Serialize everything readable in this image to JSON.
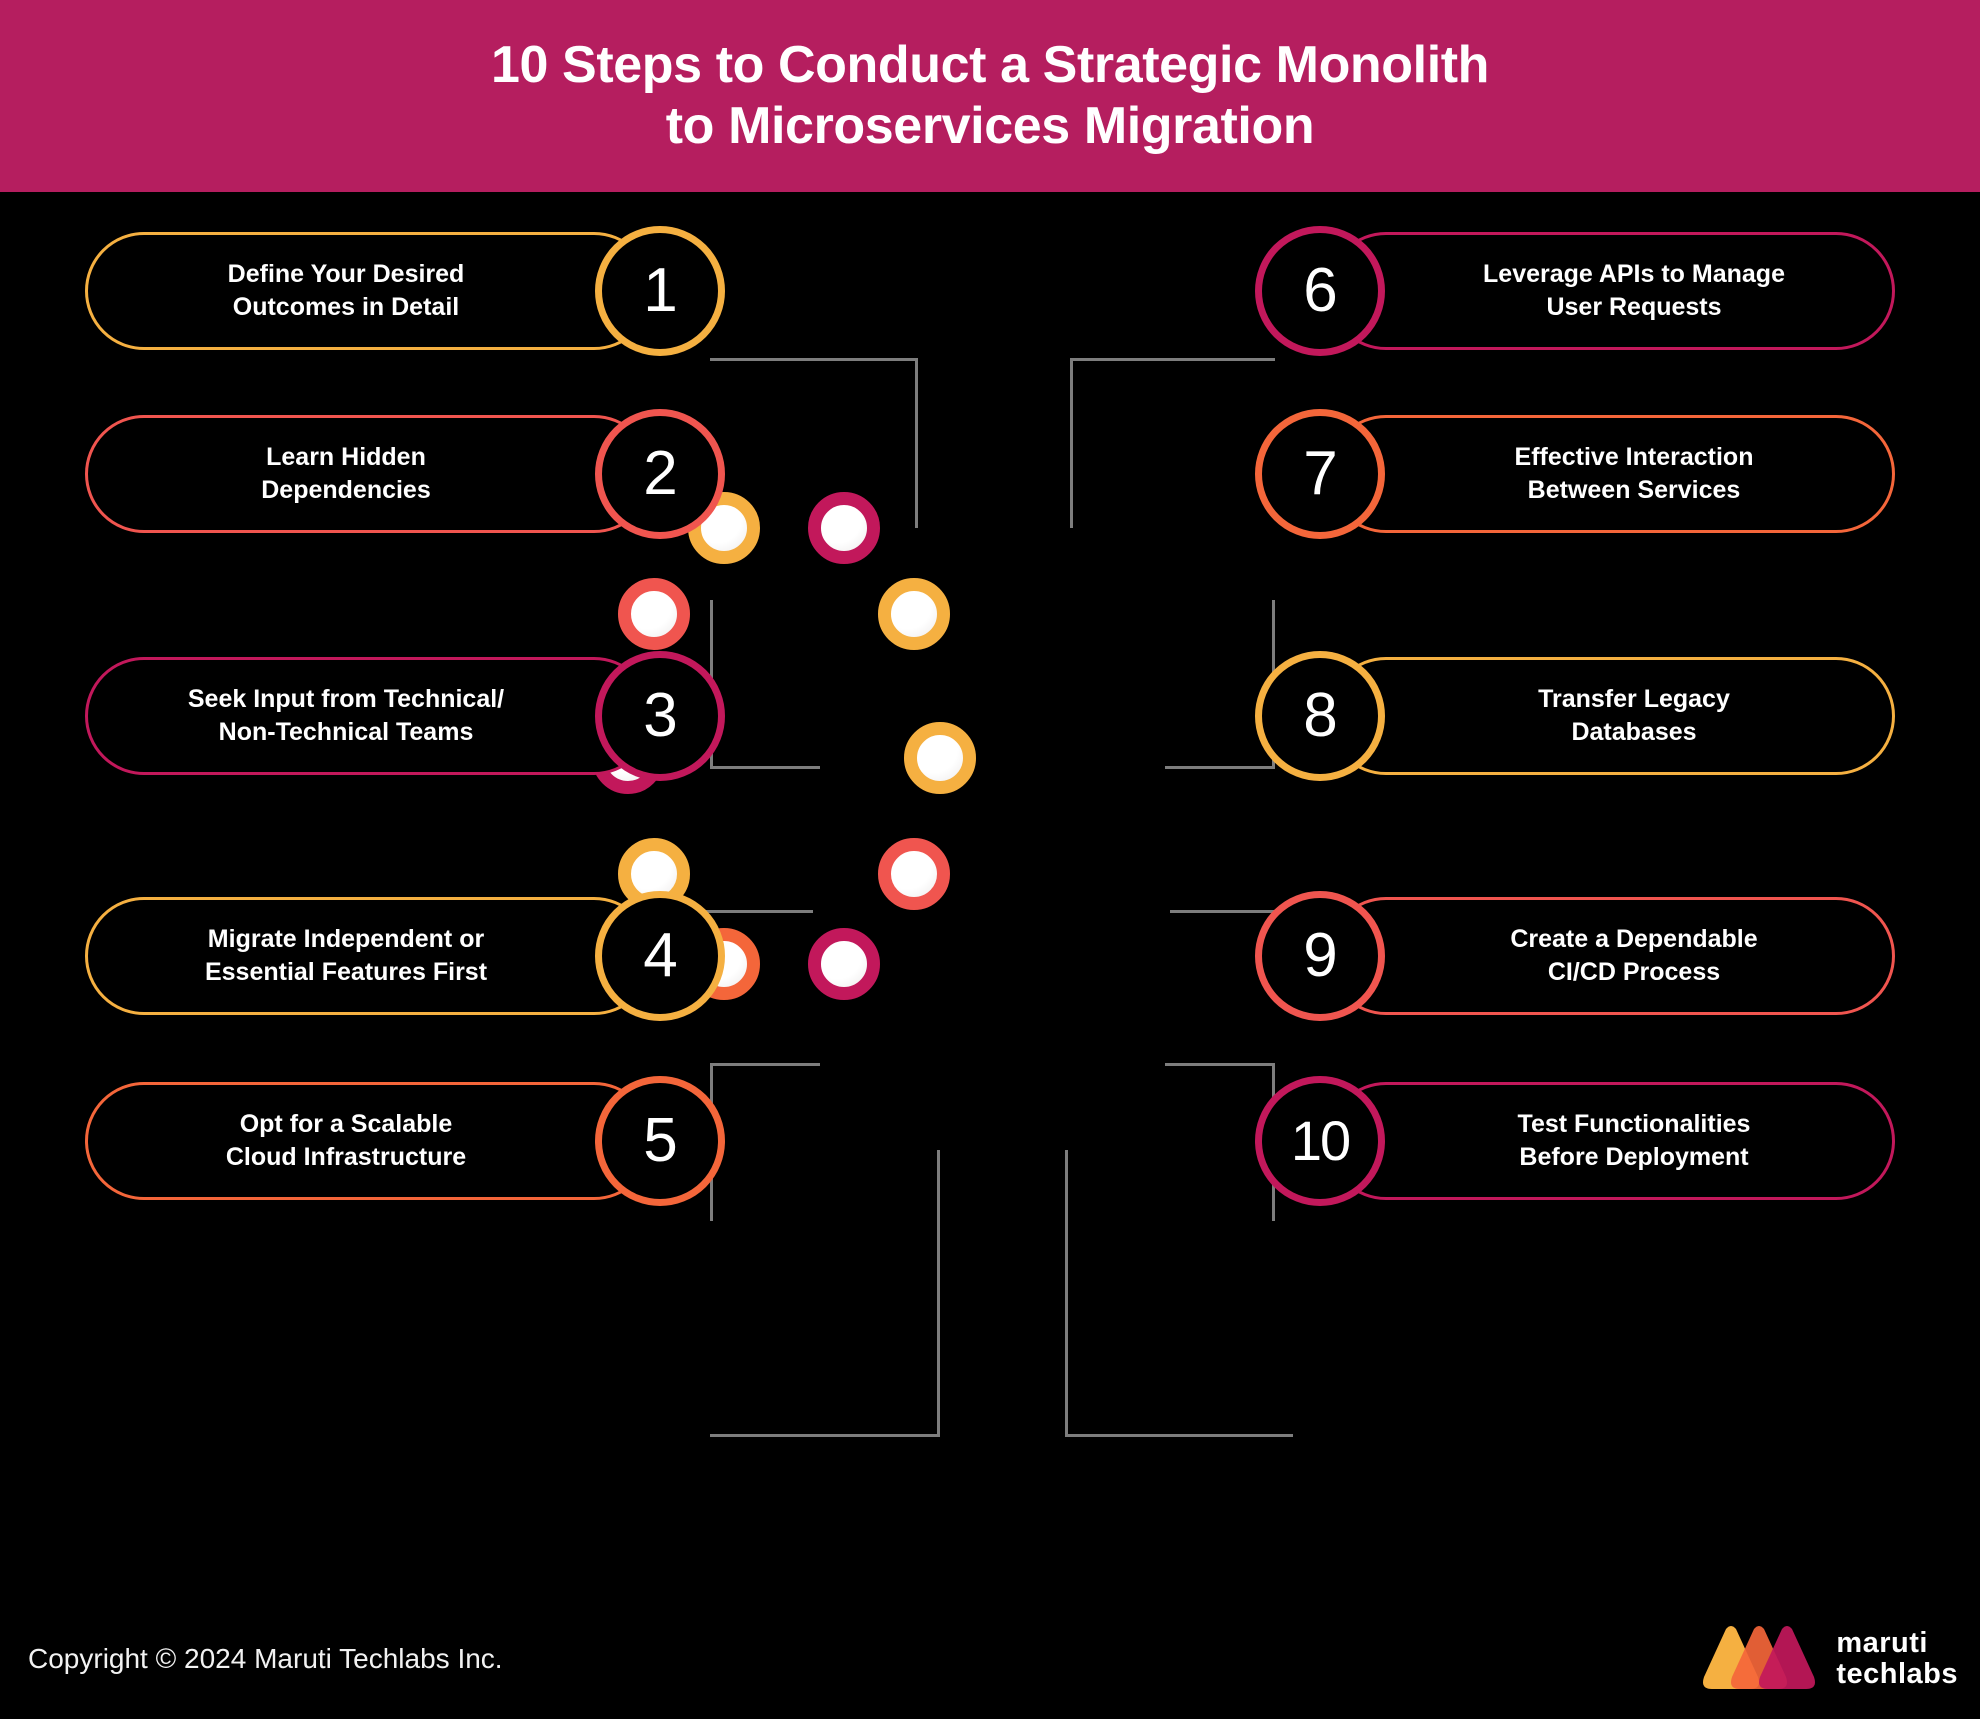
{
  "header": {
    "title_line1": "10 Steps to Conduct a Strategic Monolith",
    "title_line2": "to Microservices Migration",
    "background_color": "#b51e5f",
    "text_color": "#ffffff"
  },
  "palette": {
    "amber": "#f5b041",
    "coral": "#f0554f",
    "magenta": "#c2185b",
    "orange": "#f4663a",
    "connector_gray": "#7d7d7d",
    "background": "#000000"
  },
  "steps": [
    {
      "number": "1",
      "label": "Define Your Desired\nOutcomes in Detail",
      "color": "#f5b041",
      "side": "left"
    },
    {
      "number": "2",
      "label": "Learn Hidden\nDependencies",
      "color": "#f0554f",
      "side": "left"
    },
    {
      "number": "3",
      "label": "Seek Input from Technical/\nNon-Technical Teams",
      "color": "#c2185b",
      "side": "left"
    },
    {
      "number": "4",
      "label": "Migrate Independent or\nEssential Features First",
      "color": "#f5b041",
      "side": "left"
    },
    {
      "number": "5",
      "label": "Opt for a Scalable\nCloud Infrastructure",
      "color": "#f4663a",
      "side": "left"
    },
    {
      "number": "6",
      "label": "Leverage APIs to Manage\nUser Requests",
      "color": "#c2185b",
      "side": "right"
    },
    {
      "number": "7",
      "label": "Effective Interaction\nBetween Services",
      "color": "#f4663a",
      "side": "right"
    },
    {
      "number": "8",
      "label": "Transfer Legacy\nDatabases",
      "color": "#f5b041",
      "side": "right"
    },
    {
      "number": "9",
      "label": "Create a Dependable\nCI/CD Process",
      "color": "#f0554f",
      "side": "right"
    },
    {
      "number": "10",
      "label": "Test Functionalities\nBefore Deployment",
      "color": "#c2185b",
      "side": "right"
    }
  ],
  "center_dots": [
    {
      "ring_color": "#f5b041"
    },
    {
      "ring_color": "#c2185b"
    },
    {
      "ring_color": "#f0554f"
    },
    {
      "ring_color": "#f5b041"
    },
    {
      "ring_color": "#c2185b"
    },
    {
      "ring_color": "#f5b041"
    },
    {
      "ring_color": "#f5b041"
    },
    {
      "ring_color": "#f0554f"
    },
    {
      "ring_color": "#f4663a"
    },
    {
      "ring_color": "#c2185b"
    }
  ],
  "footer": {
    "copyright": "Copyright © 2024 Maruti Techlabs Inc.",
    "logo_line1": "maruti",
    "logo_line2": "techlabs",
    "logo_colors": [
      "#f5b041",
      "#f4663a",
      "#c2185b"
    ]
  }
}
